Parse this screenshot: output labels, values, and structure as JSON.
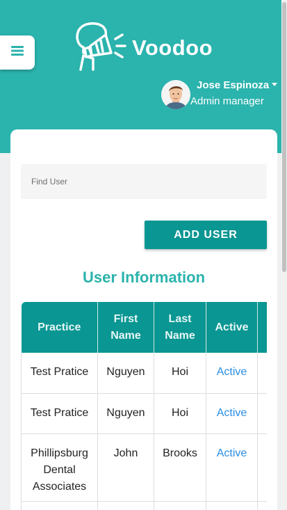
{
  "header": {
    "logo_text": "Voodoo",
    "menu_icon": "hamburger-icon",
    "user": {
      "name": "Jose Espinoza",
      "role": "Admin manager",
      "avatar_icon": "avatar-icon"
    }
  },
  "search": {
    "placeholder": "Find User",
    "value": ""
  },
  "actions": {
    "add_user_label": "ADD USER"
  },
  "section": {
    "title": "User Information"
  },
  "table": {
    "columns": [
      "Practice",
      "First Name",
      "Last Name",
      "Active"
    ],
    "rows": [
      {
        "practice": "Test Pratice",
        "first_name": "Nguyen",
        "last_name": "Hoi",
        "active": "Active"
      },
      {
        "practice": "Test Pratice",
        "first_name": "Nguyen",
        "last_name": "Hoi",
        "active": "Active"
      },
      {
        "practice": "Phillipsburg Dental Associates",
        "first_name": "John",
        "last_name": "Brooks",
        "active": "Active"
      }
    ]
  },
  "colors": {
    "brand": "#2bb3ad",
    "button": "#0a9692",
    "link": "#2a8de0"
  }
}
